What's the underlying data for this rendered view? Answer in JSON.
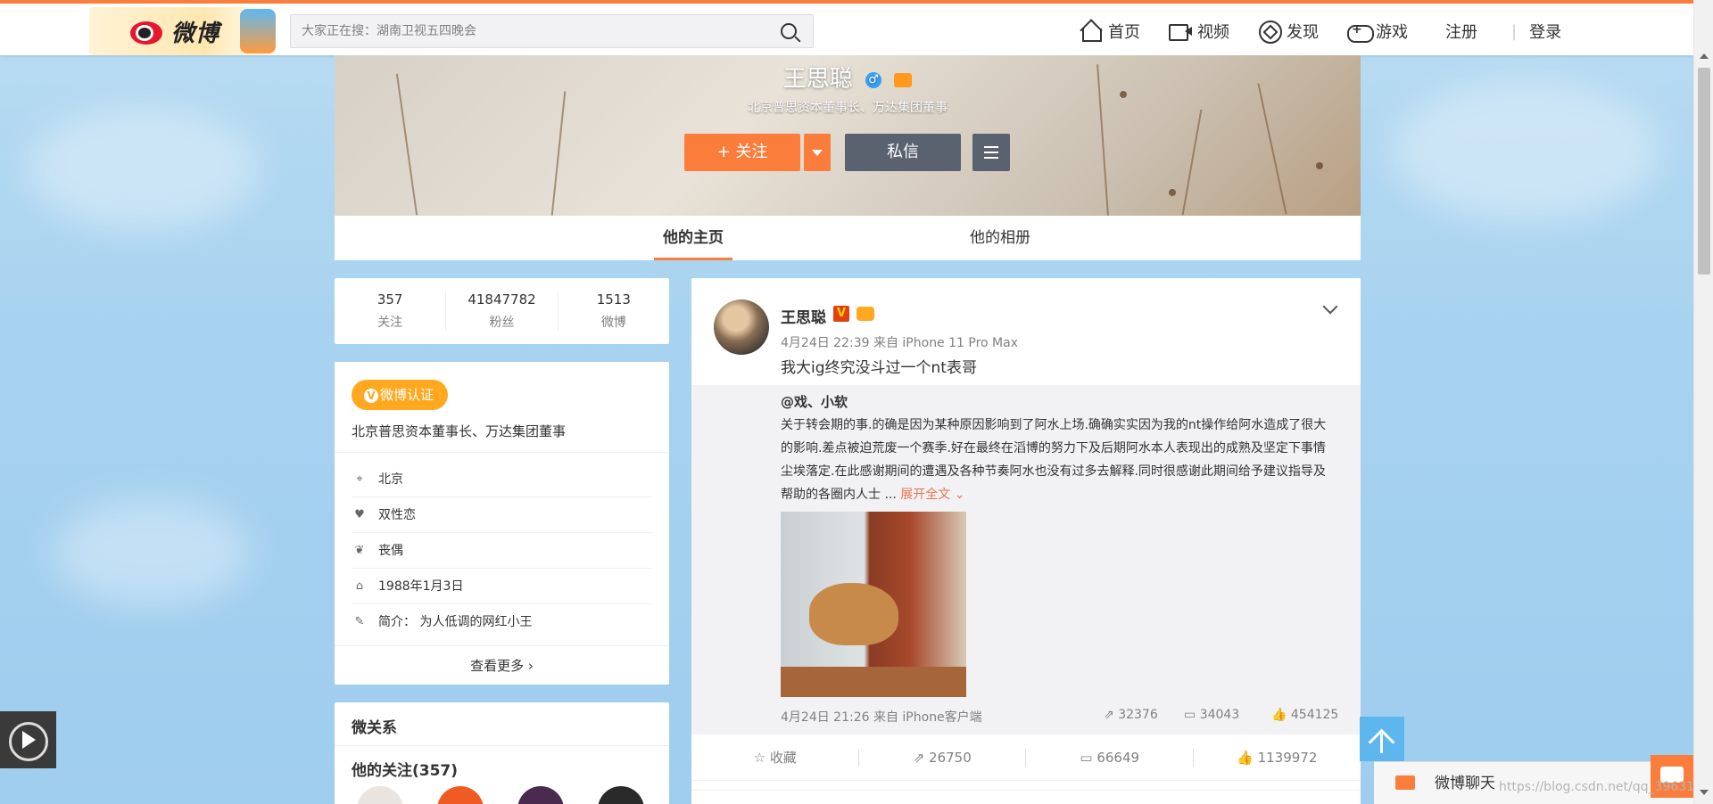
{
  "topbar": {
    "logo_text": "微博",
    "search_placeholder": "大家正在搜：湖南卫视五四晚会",
    "nav": [
      {
        "label": "首页",
        "icon": "home-icon"
      },
      {
        "label": "视频",
        "icon": "video-icon"
      },
      {
        "label": "发现",
        "icon": "compass-icon"
      },
      {
        "label": "游戏",
        "icon": "gamepad-icon"
      }
    ],
    "register": "注册",
    "login": "登录"
  },
  "profile": {
    "name": "王思聪",
    "gender_symbol": "♂",
    "description": "北京普思资本董事长、万达集团董事",
    "follow_button": "+ 关注",
    "message_button": "私信",
    "tabs": [
      "他的主页",
      "他的相册"
    ]
  },
  "stats": [
    {
      "value": "357",
      "label": "关注"
    },
    {
      "value": "41847782",
      "label": "粉丝"
    },
    {
      "value": "1513",
      "label": "微博"
    }
  ],
  "about": {
    "badge": "微博认证",
    "verified_title": "北京普思资本董事长、万达集团董事",
    "rows": [
      {
        "icon": "location-icon",
        "text": "北京"
      },
      {
        "icon": "heart-icon",
        "text": "双性恋"
      },
      {
        "icon": "hearts-icon",
        "text": "丧偶"
      },
      {
        "icon": "cake-icon",
        "text": "1988年1月3日"
      },
      {
        "icon": "edit-icon",
        "text": "简介：  为人低调的网红小王"
      }
    ],
    "more": "查看更多 ›"
  },
  "relation": {
    "title": "微关系",
    "following": "他的关注(357)"
  },
  "post": {
    "author": "王思聪",
    "verified_mark": "V",
    "meta": "4月24日 22:39 来自 iPhone 11 Pro Max",
    "text": "我大ig终究没斗过一个nt表哥",
    "repost": {
      "user": "@戏、小软",
      "text": "关于转会期的事.的确是因为某种原因影响到了阿水上场.确确实实因为我的nt操作给阿水造成了很大的影响.差点被迫荒废一个赛季.好在最终在滔博的努力下及后期阿水本人表现出的成熟及坚定下事情尘埃落定.在此感谢期间的遭遇及各种节奏阿水也没有过多去解释.同时很感谢此期间给予建议指导及帮助的各圈内人士 ... ",
      "expand": "展开全文 ⌄",
      "meta": "4月24日 21:26 来自 iPhone客户端",
      "shares": "32376",
      "comments": "34043",
      "likes": "454125"
    },
    "actions": [
      {
        "icon": "star-icon",
        "label": "☆ 收藏"
      },
      {
        "icon": "share-icon",
        "label": "⇗ 26750"
      },
      {
        "icon": "comment-icon",
        "label": "▭ 66649"
      },
      {
        "icon": "like-icon",
        "label": "👍 1139972"
      }
    ]
  },
  "chat": {
    "label": "微博聊天"
  },
  "watermark": "https://blog.csdn.net/qq_39631..."
}
